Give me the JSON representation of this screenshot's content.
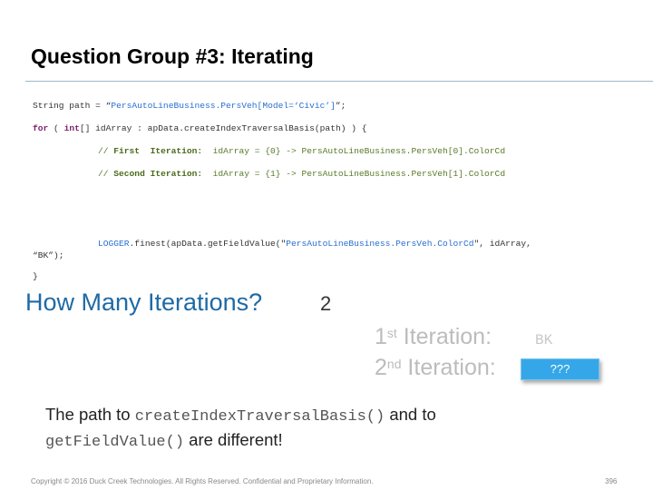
{
  "title": "Question Group #3: Iterating",
  "code": {
    "line1": {
      "pre": "String path = “",
      "str": "PersAutoLineBusiness.PersVeh[Model=‘Civic’]",
      "post": "”;"
    },
    "line2": {
      "kw1": "for",
      "a": " ( ",
      "kw2": "int",
      "b": "[] idArray : apData.createIndexTraversalBasis(path) ) {"
    },
    "line3": {
      "c1": "// ",
      "bold": "First  Iteration:",
      "c2": "  idArray = {0} -> PersAutoLineBusiness.PersVeh[0].ColorCd"
    },
    "line4": {
      "c1": "// ",
      "bold": "Second Iteration:",
      "c2": "  idArray = {1} -> PersAutoLineBusiness.PersVeh[1].ColorCd"
    },
    "line5": {
      "logger": "LOGGER",
      "a": ".finest(apData.getFieldValue(\"",
      "str": "PersAutoLineBusiness.PersVeh.ColorCd",
      "b": "\", idArray,"
    },
    "line6": "“BK”);",
    "line7": "}"
  },
  "question": "How Many Iterations?",
  "answer": "2",
  "iter1": {
    "num": "1",
    "sup": "st",
    "label": " Iteration:",
    "value": "BK"
  },
  "iter2": {
    "num": "2",
    "sup": "nd",
    "label": " Iteration:",
    "button": "???"
  },
  "note": {
    "pre": "The path to ",
    "code1": "createIndexTraversalBasis()",
    "mid": " and to",
    "code2": "getFieldValue()",
    "post": " are different!"
  },
  "footer": "Copyright © 2016 Duck Creek Technologies. All Rights Reserved. Confidential and Proprietary Information.",
  "page_number": "396"
}
